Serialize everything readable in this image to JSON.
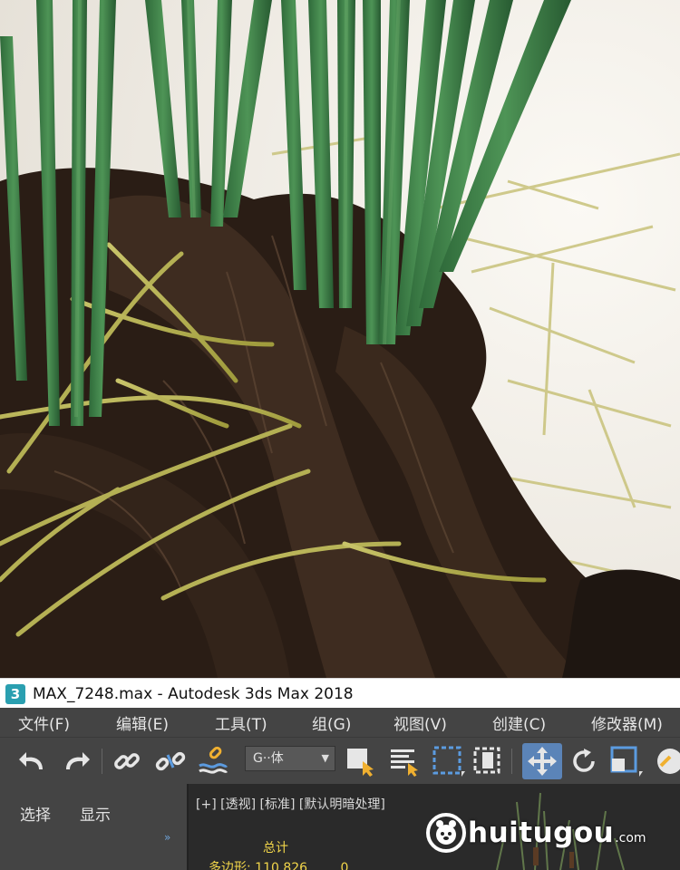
{
  "window": {
    "app_icon_text": "3",
    "title": "MAX_7248.max - Autodesk 3ds Max 2018"
  },
  "menu": {
    "items": [
      "文件(F)",
      "编辑(E)",
      "工具(T)",
      "组(G)",
      "视图(V)",
      "创建(C)",
      "修改器(M)"
    ]
  },
  "toolbar": {
    "selection_set_value": "G··体",
    "icons": [
      "undo-icon",
      "redo-icon",
      "link-icon",
      "unlink-icon",
      "bind-space-warp-icon",
      "select-object-icon",
      "select-by-name-icon",
      "rectangular-selection-icon",
      "window-crossing-icon",
      "select-move-icon",
      "select-rotate-icon",
      "select-scale-icon",
      "snap-icon"
    ]
  },
  "command_panel": {
    "tabs": [
      "选择",
      "显示"
    ],
    "chevron": "»"
  },
  "viewport": {
    "label": "[+] [透视] [标准] [默认明暗处理]",
    "stats_title": "总计",
    "stats_rows": [
      {
        "label": "多边形:",
        "total": "110,826",
        "selected": "0"
      }
    ]
  },
  "watermark": {
    "text": "huitugou",
    "suffix": ".com"
  },
  "colors": {
    "render_background": "#f3f1ec",
    "ui_dark": "#444444",
    "active_tool": "#5b84b8",
    "accent_teal": "#2a9fb0",
    "stats_yellow": "#f2d64a"
  }
}
